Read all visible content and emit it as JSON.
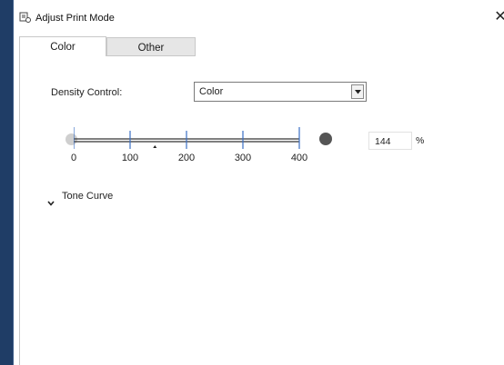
{
  "window": {
    "title": "Adjust Print Mode"
  },
  "tabs": [
    {
      "label": "Color",
      "active": true
    },
    {
      "label": "Other",
      "active": false
    }
  ],
  "density": {
    "label": "Density Control:",
    "selected": "Color",
    "value": "144",
    "unit": "%",
    "ticks": [
      "0",
      "100",
      "200",
      "300",
      "400"
    ],
    "min": 0,
    "max": 400,
    "current": 144
  },
  "tone_curve": {
    "label": "Tone Curve",
    "expanded": false
  },
  "colors": {
    "accent": "#3a6fc4",
    "background": "#1f3d66"
  },
  "icons": {
    "app": "printer-settings-icon",
    "close": "close-icon",
    "dropdown": "chevron-down-icon",
    "expander": "chevron-down-icon"
  }
}
